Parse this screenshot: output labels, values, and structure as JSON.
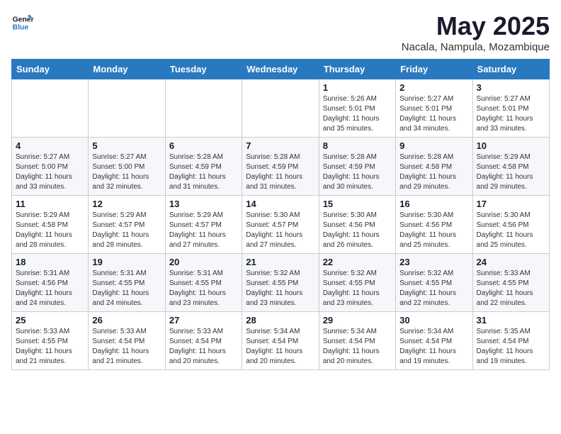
{
  "logo": {
    "line1": "General",
    "line2": "Blue"
  },
  "title": "May 2025",
  "subtitle": "Nacala, Nampula, Mozambique",
  "weekdays": [
    "Sunday",
    "Monday",
    "Tuesday",
    "Wednesday",
    "Thursday",
    "Friday",
    "Saturday"
  ],
  "weeks": [
    [
      {
        "day": "",
        "detail": ""
      },
      {
        "day": "",
        "detail": ""
      },
      {
        "day": "",
        "detail": ""
      },
      {
        "day": "",
        "detail": ""
      },
      {
        "day": "1",
        "detail": "Sunrise: 5:26 AM\nSunset: 5:01 PM\nDaylight: 11 hours\nand 35 minutes."
      },
      {
        "day": "2",
        "detail": "Sunrise: 5:27 AM\nSunset: 5:01 PM\nDaylight: 11 hours\nand 34 minutes."
      },
      {
        "day": "3",
        "detail": "Sunrise: 5:27 AM\nSunset: 5:01 PM\nDaylight: 11 hours\nand 33 minutes."
      }
    ],
    [
      {
        "day": "4",
        "detail": "Sunrise: 5:27 AM\nSunset: 5:00 PM\nDaylight: 11 hours\nand 33 minutes."
      },
      {
        "day": "5",
        "detail": "Sunrise: 5:27 AM\nSunset: 5:00 PM\nDaylight: 11 hours\nand 32 minutes."
      },
      {
        "day": "6",
        "detail": "Sunrise: 5:28 AM\nSunset: 4:59 PM\nDaylight: 11 hours\nand 31 minutes."
      },
      {
        "day": "7",
        "detail": "Sunrise: 5:28 AM\nSunset: 4:59 PM\nDaylight: 11 hours\nand 31 minutes."
      },
      {
        "day": "8",
        "detail": "Sunrise: 5:28 AM\nSunset: 4:59 PM\nDaylight: 11 hours\nand 30 minutes."
      },
      {
        "day": "9",
        "detail": "Sunrise: 5:28 AM\nSunset: 4:58 PM\nDaylight: 11 hours\nand 29 minutes."
      },
      {
        "day": "10",
        "detail": "Sunrise: 5:29 AM\nSunset: 4:58 PM\nDaylight: 11 hours\nand 29 minutes."
      }
    ],
    [
      {
        "day": "11",
        "detail": "Sunrise: 5:29 AM\nSunset: 4:58 PM\nDaylight: 11 hours\nand 28 minutes."
      },
      {
        "day": "12",
        "detail": "Sunrise: 5:29 AM\nSunset: 4:57 PM\nDaylight: 11 hours\nand 28 minutes."
      },
      {
        "day": "13",
        "detail": "Sunrise: 5:29 AM\nSunset: 4:57 PM\nDaylight: 11 hours\nand 27 minutes."
      },
      {
        "day": "14",
        "detail": "Sunrise: 5:30 AM\nSunset: 4:57 PM\nDaylight: 11 hours\nand 27 minutes."
      },
      {
        "day": "15",
        "detail": "Sunrise: 5:30 AM\nSunset: 4:56 PM\nDaylight: 11 hours\nand 26 minutes."
      },
      {
        "day": "16",
        "detail": "Sunrise: 5:30 AM\nSunset: 4:56 PM\nDaylight: 11 hours\nand 25 minutes."
      },
      {
        "day": "17",
        "detail": "Sunrise: 5:30 AM\nSunset: 4:56 PM\nDaylight: 11 hours\nand 25 minutes."
      }
    ],
    [
      {
        "day": "18",
        "detail": "Sunrise: 5:31 AM\nSunset: 4:56 PM\nDaylight: 11 hours\nand 24 minutes."
      },
      {
        "day": "19",
        "detail": "Sunrise: 5:31 AM\nSunset: 4:55 PM\nDaylight: 11 hours\nand 24 minutes."
      },
      {
        "day": "20",
        "detail": "Sunrise: 5:31 AM\nSunset: 4:55 PM\nDaylight: 11 hours\nand 23 minutes."
      },
      {
        "day": "21",
        "detail": "Sunrise: 5:32 AM\nSunset: 4:55 PM\nDaylight: 11 hours\nand 23 minutes."
      },
      {
        "day": "22",
        "detail": "Sunrise: 5:32 AM\nSunset: 4:55 PM\nDaylight: 11 hours\nand 23 minutes."
      },
      {
        "day": "23",
        "detail": "Sunrise: 5:32 AM\nSunset: 4:55 PM\nDaylight: 11 hours\nand 22 minutes."
      },
      {
        "day": "24",
        "detail": "Sunrise: 5:33 AM\nSunset: 4:55 PM\nDaylight: 11 hours\nand 22 minutes."
      }
    ],
    [
      {
        "day": "25",
        "detail": "Sunrise: 5:33 AM\nSunset: 4:55 PM\nDaylight: 11 hours\nand 21 minutes."
      },
      {
        "day": "26",
        "detail": "Sunrise: 5:33 AM\nSunset: 4:54 PM\nDaylight: 11 hours\nand 21 minutes."
      },
      {
        "day": "27",
        "detail": "Sunrise: 5:33 AM\nSunset: 4:54 PM\nDaylight: 11 hours\nand 20 minutes."
      },
      {
        "day": "28",
        "detail": "Sunrise: 5:34 AM\nSunset: 4:54 PM\nDaylight: 11 hours\nand 20 minutes."
      },
      {
        "day": "29",
        "detail": "Sunrise: 5:34 AM\nSunset: 4:54 PM\nDaylight: 11 hours\nand 20 minutes."
      },
      {
        "day": "30",
        "detail": "Sunrise: 5:34 AM\nSunset: 4:54 PM\nDaylight: 11 hours\nand 19 minutes."
      },
      {
        "day": "31",
        "detail": "Sunrise: 5:35 AM\nSunset: 4:54 PM\nDaylight: 11 hours\nand 19 minutes."
      }
    ]
  ]
}
